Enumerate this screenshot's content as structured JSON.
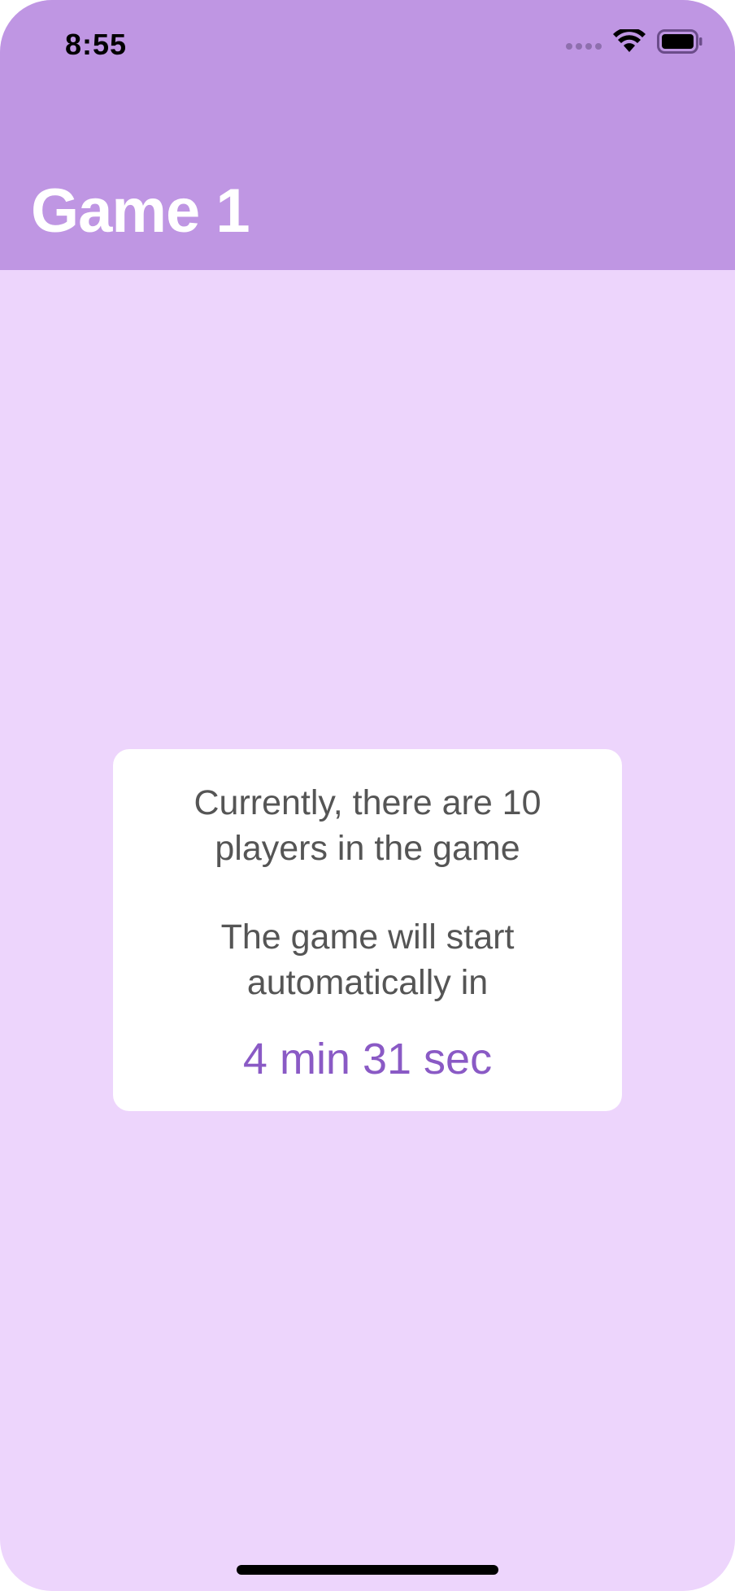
{
  "status_bar": {
    "time": "8:55"
  },
  "header": {
    "title": "Game 1"
  },
  "card": {
    "players_line1": "Currently, there are 10",
    "players_line2": "players in the game",
    "start_line1": "The game will start",
    "start_line2": "automatically in",
    "countdown": "4 min 31 sec"
  },
  "colors": {
    "header_bg": "#BF96E3",
    "page_bg": "#EDD5FC",
    "card_bg": "#FFFFFF",
    "body_text": "#555555",
    "countdown_text": "#8A5AC5",
    "title_text": "#FFFFFF"
  },
  "icons": {
    "signal": "signal-dots-icon",
    "wifi": "wifi-icon",
    "battery": "battery-icon"
  }
}
